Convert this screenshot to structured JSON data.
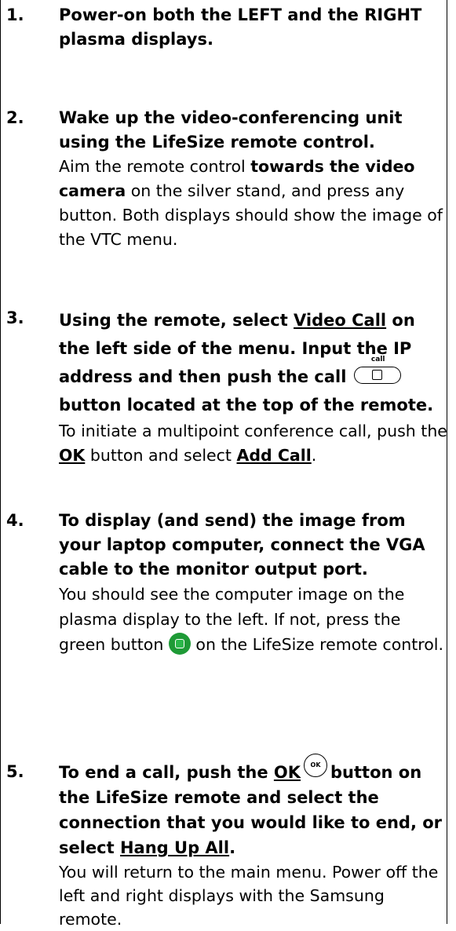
{
  "steps": [
    {
      "number": "1.",
      "heading": "Power-on both the LEFT and the RIGHT plasma displays."
    },
    {
      "number": "2.",
      "heading": "Wake up the video-conferencing unit using the LifeSize remote control.",
      "text_1": "Aim the remote control ",
      "text_bold": "towards the video camera",
      "text_2": " on the silver stand, and press any button. Both displays should show the image of the VTC menu."
    },
    {
      "number": "3.",
      "heading_1": "Using the remote, select ",
      "heading_link": "Video Call",
      "heading_2": " on the left side of the menu.  Input the IP address and then push the call",
      "heading_3": "button located at the top of the remote.",
      "call_icon_label": "call",
      "text_1": "To initiate a multipoint conference call, push the ",
      "text_ok": "OK",
      "text_2": " button and select ",
      "text_add": "Add Call",
      "text_3": "."
    },
    {
      "number": "4.",
      "heading": "To display (and send) the image from your laptop computer, connect the VGA cable to the monitor output port.",
      "text_1": "You should see the computer image on the plasma display to the left. If not, press the green button",
      "text_2": "on the LifeSize remote control."
    },
    {
      "number": "5.",
      "heading_1": "To end a call, push the ",
      "heading_ok": "OK",
      "heading_2": "button on the LifeSize remote and select the connection that you would like to end, or select ",
      "heading_hang": "Hang Up All",
      "heading_3": ".",
      "ok_icon_label": "OK",
      "text": "You will return to the main menu. Power off the left and right displays with the Samsung remote."
    }
  ],
  "icons": {
    "call_button": "call-button-icon",
    "green_button": "green-button-icon",
    "ok_button": "ok-button-icon"
  },
  "colors": {
    "green_button": "#1e9a36"
  }
}
